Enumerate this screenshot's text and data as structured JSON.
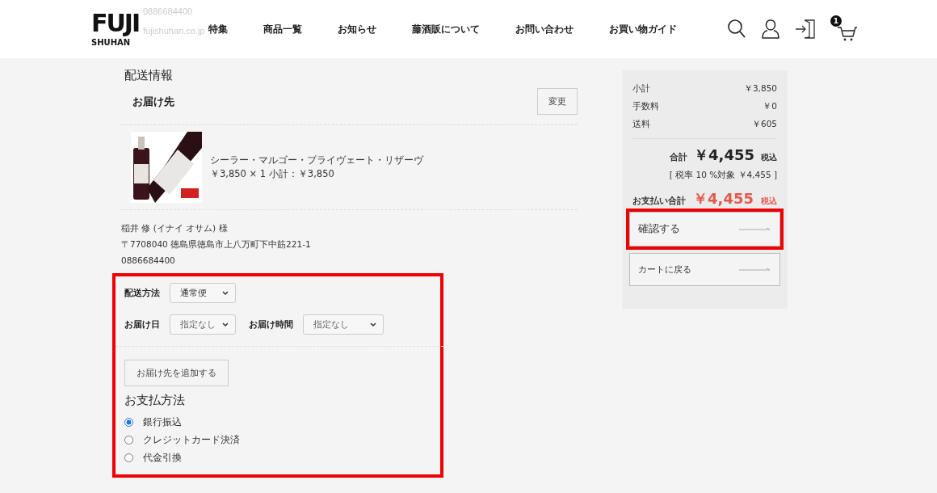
{
  "header": {
    "logo": {
      "top": "FUJI",
      "bottom": "SHUHAN"
    },
    "phone": "0886684400",
    "email": "fujishuhan.co.jp",
    "nav": [
      "特集",
      "商品一覧",
      "お知らせ",
      "藤酒販について",
      "お問い合わせ",
      "お買い物ガイド"
    ],
    "cart_count": "1"
  },
  "page_title": "配送情報",
  "destination": {
    "title": "お届け先",
    "change_button": "変更",
    "items": [
      {
        "name": "シーラー・マルゴー・プライヴェート・リザーヴ",
        "price_line": "￥3,850 × 1  小計：￥3,850"
      }
    ],
    "address": [
      "稲井 修 (イナイ オサム) 様",
      "〒7708040 徳島県徳島市上八万町下中筋221-1",
      "0886684400"
    ]
  },
  "options": {
    "highlighted": true,
    "shipping_method": {
      "label": "配送方法",
      "value": "通常便"
    },
    "delivery_date": {
      "label": "お届け日",
      "value": "指定なし"
    },
    "delivery_time": {
      "label": "お届け時間",
      "value": "指定なし"
    },
    "add_destination_button": "お届け先を追加する",
    "payment": {
      "title": "お支払方法",
      "methods": [
        {
          "label": "銀行振込",
          "selected": true
        },
        {
          "label": "クレジットカード決済",
          "selected": false
        },
        {
          "label": "代金引換",
          "selected": false
        }
      ]
    }
  },
  "summary": {
    "rows": [
      {
        "label": "小計",
        "value": "￥3,850"
      },
      {
        "label": "手数料",
        "value": "￥0"
      },
      {
        "label": "送料",
        "value": "￥605"
      }
    ],
    "total": {
      "label": "合計",
      "value": "￥4,455",
      "suffix": "税込"
    },
    "tax_note": "[ 税率 10 %対象  ￥4,455 ]",
    "payment_total": {
      "label": "お支払い合計",
      "value": "￥4,455",
      "suffix": "税込"
    },
    "buttons": [
      {
        "label": "確認する",
        "highlighted": true
      },
      {
        "label": "カートに戻る",
        "highlighted": false
      }
    ]
  }
}
